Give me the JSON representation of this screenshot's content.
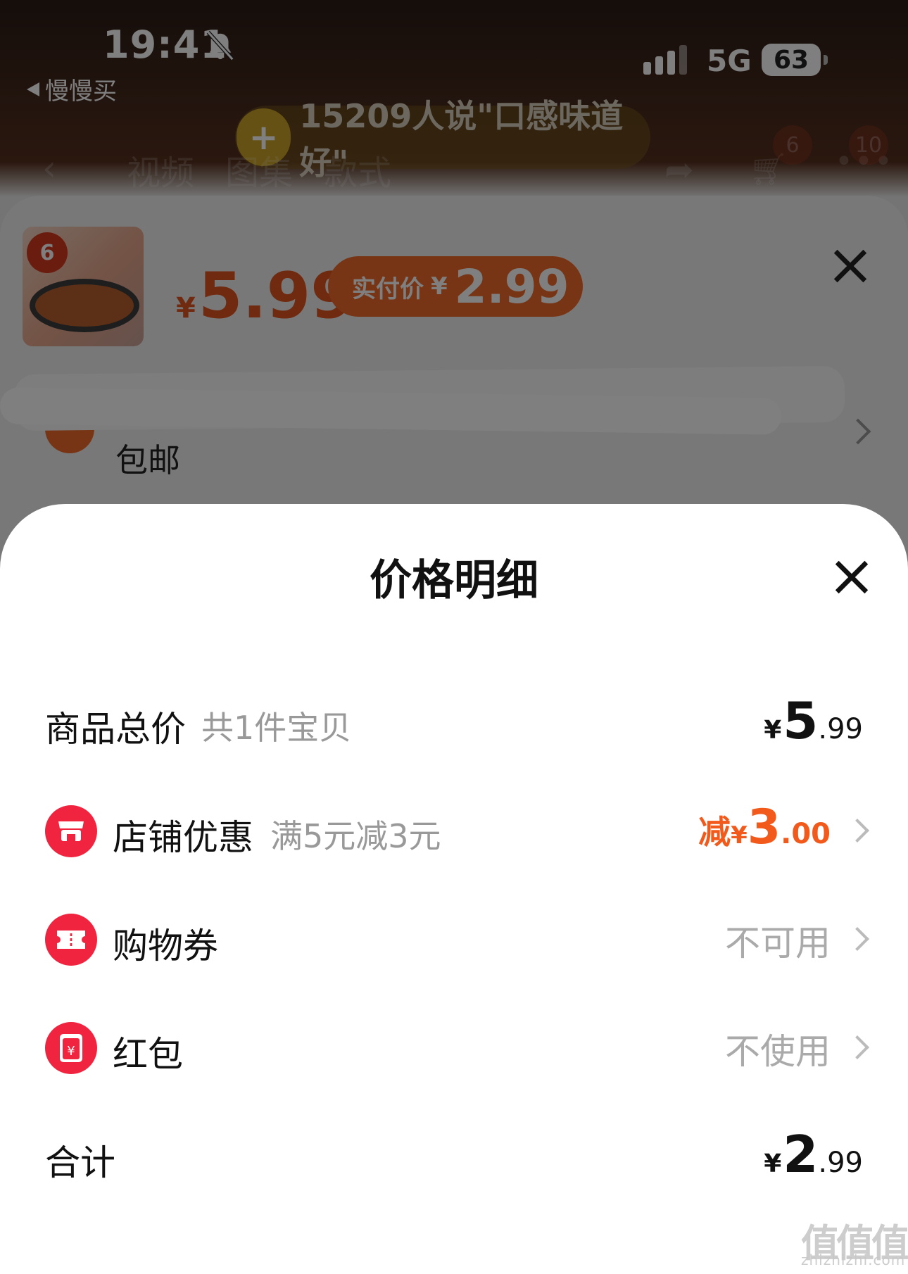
{
  "status_bar": {
    "time": "19:41",
    "back_app": "慢慢买",
    "network": "5G",
    "battery": "63"
  },
  "product_page": {
    "rating_text": "15209人说\"口感味道好\"",
    "tabs": [
      "视频",
      "图集",
      "款式"
    ],
    "cart_badge": "6",
    "more_badge": "10"
  },
  "sku_sheet": {
    "thumb_tag": "6",
    "price_currency": "¥",
    "price": "5.99",
    "paid_label": "实付价",
    "paid_currency": "¥",
    "paid_value": "2.99",
    "shipping": "包邮"
  },
  "price_detail": {
    "title": "价格明细",
    "total": {
      "label": "商品总价",
      "sub": "共1件宝贝",
      "currency": "¥",
      "int": "5",
      "dec": ".99"
    },
    "store_discount": {
      "label": "店铺优惠",
      "sub": "满5元减3元",
      "prefix": "减",
      "currency": "¥",
      "int": "3",
      "dec": ".00"
    },
    "coupon": {
      "label": "购物券",
      "status": "不可用"
    },
    "red_packet": {
      "label": "红包",
      "status": "不使用"
    },
    "sum": {
      "label": "合计",
      "currency": "¥",
      "int": "2",
      "dec": ".99"
    }
  },
  "watermark": {
    "mark": "值值值",
    "site": "zhizhizhi.com"
  },
  "colors": {
    "accent": "#f25a1c",
    "icon_red": "#f0243f",
    "paid_orange": "#ef6a2b"
  }
}
